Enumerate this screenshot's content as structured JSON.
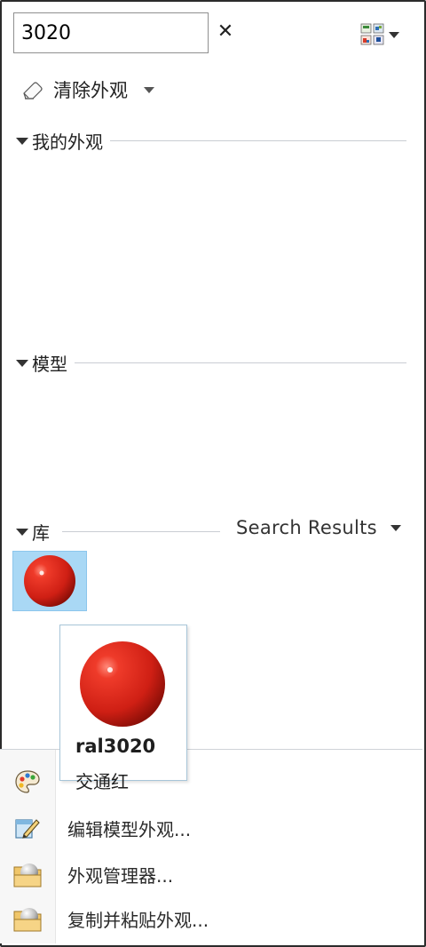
{
  "search": {
    "value": "3020"
  },
  "icons": {
    "clear": "close-icon",
    "view_switch": "view-grid-icon",
    "eraser": "eraser-icon",
    "palette": "palette-icon",
    "edit": "edit-appearance-icon",
    "manager": "appearance-manager-icon",
    "copy_paste": "copy-paste-appearance-icon"
  },
  "clear_appearance": {
    "label": "清除外观"
  },
  "sections": {
    "my_appearances": {
      "label": "我的外观"
    },
    "model": {
      "label": "模型"
    },
    "library": {
      "label": "库",
      "filter_label": "Search Results"
    }
  },
  "library_items": [
    {
      "name": "ral3020",
      "description": "交通红",
      "color": "#d4231a",
      "selected": true
    }
  ],
  "tooltip": {
    "name": "ral3020",
    "description": "交通红"
  },
  "menu": {
    "edit_model": "编辑模型外观...",
    "manager": "外观管理器...",
    "copy_paste": "复制并粘贴外观..."
  },
  "colors": {
    "selection_bg": "#a9d8f5",
    "ball_red": "#d4231a"
  }
}
